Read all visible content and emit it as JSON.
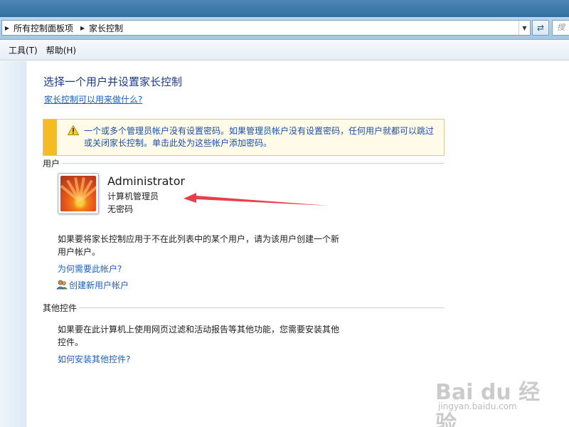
{
  "address_bar": {
    "breadcrumbs": [
      "所有控制面板项",
      "家长控制"
    ],
    "search_placeholder": "搜"
  },
  "menu": {
    "items": [
      "工具(T)",
      "帮助(H)"
    ]
  },
  "page": {
    "title": "选择一个用户并设置家长控制",
    "help_link": "家长控制可以用来做什么?"
  },
  "warning": {
    "line1": "一个或多个管理员帐户没有设置密码。如果管理员帐户没有设置密码，任何用户就都可以跳过",
    "line2": "或关闭家长控制。单击此处为这些帐户添加密码。"
  },
  "users_section": {
    "header": "用户",
    "user": {
      "name": "Administrator",
      "role": "计算机管理员",
      "password_status": "无密码"
    },
    "info_line1": "如果要将家长控制应用于不在此列表中的某个用户，请为该用户创建一个新",
    "info_line2": "用户帐户。",
    "why_link": "为何需要此帐户?",
    "create_link": "创建新用户帐户"
  },
  "other_controls": {
    "header": "其他控件",
    "info_line1": "如果要在此计算机上使用网页过滤和活动报告等其他功能，您需要安装其他",
    "info_line2": "控件。",
    "install_link": "如何安装其他控件?"
  },
  "watermark": {
    "brand": "Bai du 经验",
    "url": "jingyan.baidu.com"
  },
  "colors": {
    "link": "#1c5fbf",
    "title": "#1f3b84",
    "warning_bar": "#f4bc22",
    "annotation_arrow": "#e8404a"
  }
}
